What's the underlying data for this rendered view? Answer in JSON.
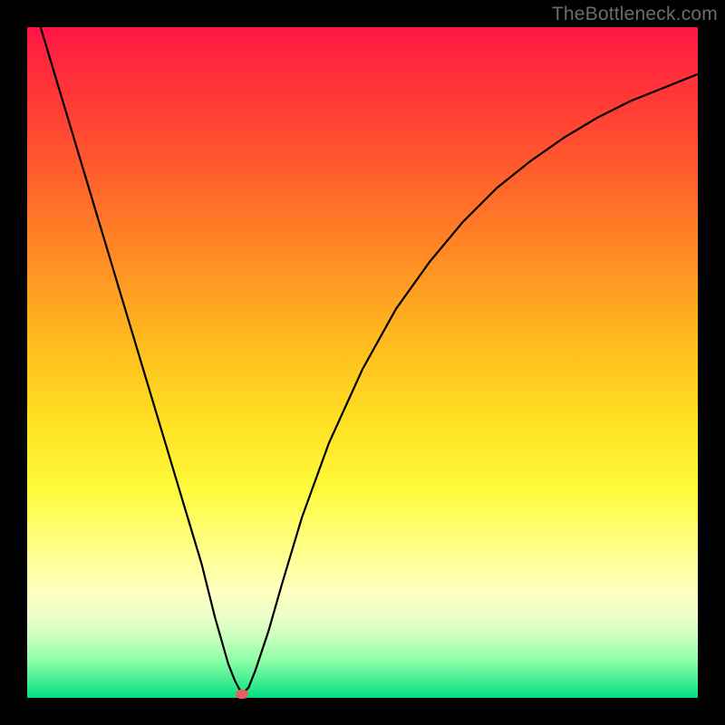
{
  "watermark": "TheBottleneck.com",
  "colors": {
    "background": "#000000",
    "gradient_top": "#FF1446",
    "gradient_mid": "#FFD21E",
    "gradient_bottom": "#00E182",
    "curve": "#000000",
    "marker": "#E65F5F"
  },
  "chart_data": {
    "type": "line",
    "title": "",
    "xlabel": "",
    "ylabel": "",
    "xlim": [
      0,
      100
    ],
    "ylim": [
      0,
      100
    ],
    "grid": false,
    "legend": false,
    "series": [
      {
        "name": "bottleneck-curve",
        "x": [
          0,
          2,
          5,
          8,
          11,
          14,
          17,
          20,
          23,
          26,
          28,
          30,
          31,
          32,
          33,
          34,
          36,
          38,
          41,
          45,
          50,
          55,
          60,
          65,
          70,
          75,
          80,
          85,
          90,
          95,
          100
        ],
        "y": [
          108,
          100,
          90,
          80,
          70,
          60,
          50,
          40,
          30,
          20,
          12,
          5,
          2.5,
          0.6,
          1.5,
          4,
          10,
          17,
          27,
          38,
          49,
          58,
          65,
          71,
          76,
          80,
          83.5,
          86.5,
          89,
          91,
          93
        ]
      }
    ],
    "annotations": [
      {
        "name": "optimal-point-marker",
        "x": 32,
        "y": 0.6
      }
    ]
  }
}
